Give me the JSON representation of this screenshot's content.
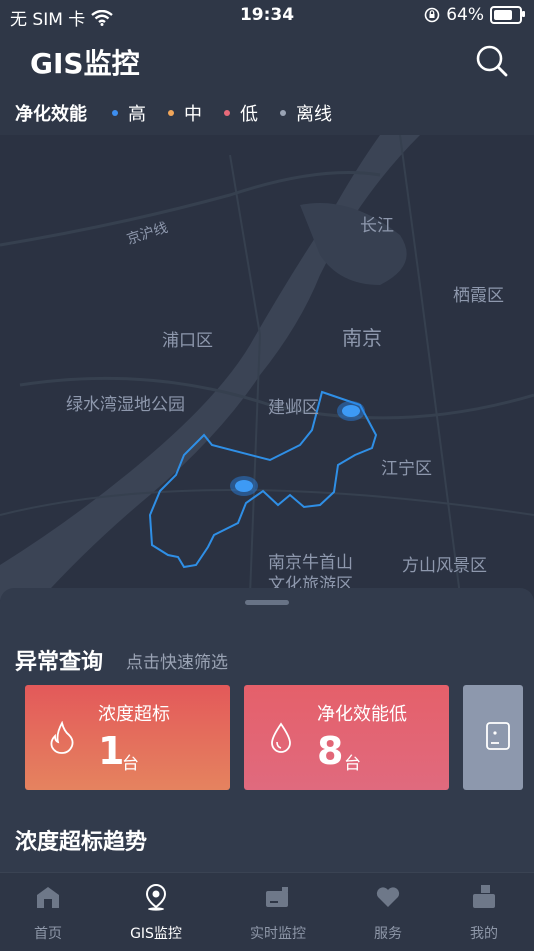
{
  "status_bar": {
    "carrier": "无 SIM 卡",
    "time": "19:34",
    "battery": "64%"
  },
  "header": {
    "title": "GIS监控"
  },
  "legend": {
    "label": "净化效能",
    "items": [
      {
        "label": "高",
        "color": "#3d8ef0"
      },
      {
        "label": "中",
        "color": "#f2a65a"
      },
      {
        "label": "低",
        "color": "#e86a7a"
      },
      {
        "label": "离线",
        "color": "#9aa3b4"
      }
    ]
  },
  "map": {
    "labels": {
      "jinghu": "京沪线",
      "changjiang": "长江",
      "qixia": "栖霞区",
      "pukou": "浦口区",
      "nanjing": "南京",
      "lvshuiwan": "绿水湾湿地公园",
      "jianye": "建邺区",
      "jiangning": "江宁区",
      "niushou1": "南京牛首山",
      "niushou2": "文化旅游区",
      "fangshan": "方山风景区"
    }
  },
  "anomaly": {
    "title": "异常查询",
    "subtitle": "点击快速筛选",
    "cards": [
      {
        "label": "浓度超标",
        "value": "1",
        "unit": "台",
        "icon": "flame-icon"
      },
      {
        "label": "净化效能低",
        "value": "8",
        "unit": "台",
        "icon": "drop-icon"
      },
      {
        "icon": "device-icon"
      }
    ]
  },
  "trend": {
    "title": "浓度超标趋势"
  },
  "tabs": [
    {
      "label": "首页",
      "icon": "home-icon"
    },
    {
      "label": "GIS监控",
      "icon": "map-pin-icon",
      "active": true
    },
    {
      "label": "实时监控",
      "icon": "monitor-icon"
    },
    {
      "label": "服务",
      "icon": "heart-icon"
    },
    {
      "label": "我的",
      "icon": "user-icon"
    }
  ]
}
